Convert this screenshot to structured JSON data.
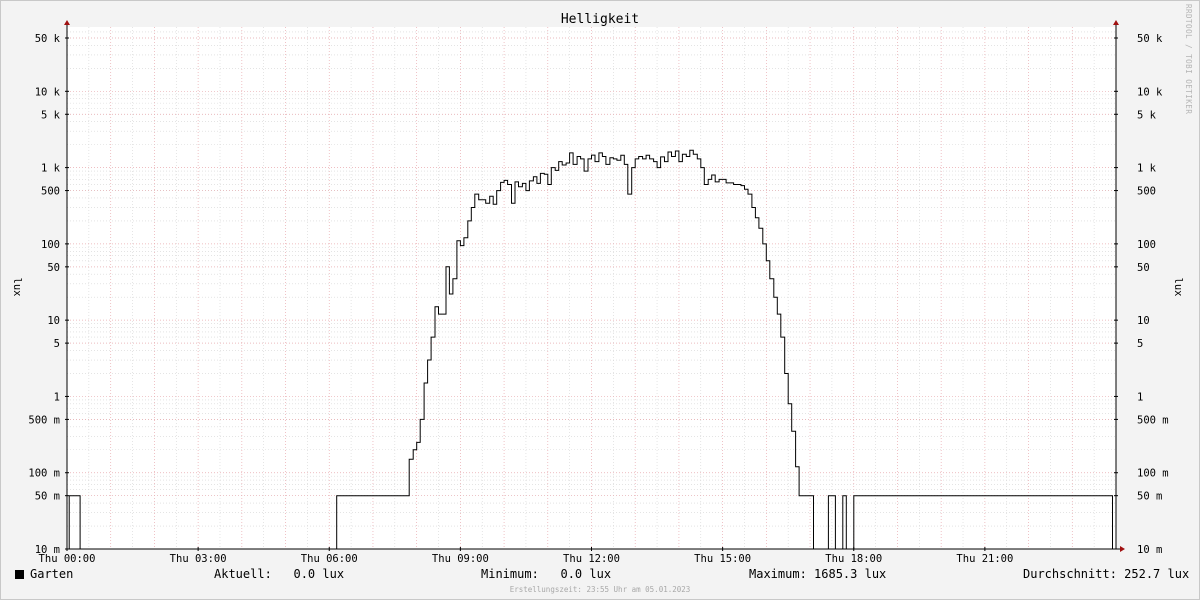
{
  "chart_data": {
    "type": "line",
    "title": "Helligkeit",
    "ylabel": "lux",
    "ylabel_right": "lux",
    "y_scale": "log",
    "ylim": [
      0.01,
      60000
    ],
    "y_ticks": [
      {
        "value": 0.01,
        "label": "10 m"
      },
      {
        "value": 0.05,
        "label": "50 m"
      },
      {
        "value": 0.1,
        "label": "100 m"
      },
      {
        "value": 0.5,
        "label": "500 m"
      },
      {
        "value": 1,
        "label": "1"
      },
      {
        "value": 5,
        "label": "5"
      },
      {
        "value": 10,
        "label": "10"
      },
      {
        "value": 50,
        "label": "50"
      },
      {
        "value": 100,
        "label": "100"
      },
      {
        "value": 500,
        "label": "500"
      },
      {
        "value": 1000,
        "label": "1 k"
      },
      {
        "value": 5000,
        "label": "5 k"
      },
      {
        "value": 10000,
        "label": "10 k"
      },
      {
        "value": 50000,
        "label": "50 k"
      }
    ],
    "x_unit": "hour",
    "xlim": [
      0,
      24
    ],
    "x_ticks": [
      {
        "value": 0,
        "label": "Thu 00:00"
      },
      {
        "value": 3,
        "label": "Thu 03:00"
      },
      {
        "value": 6,
        "label": "Thu 06:00"
      },
      {
        "value": 9,
        "label": "Thu 09:00"
      },
      {
        "value": 12,
        "label": "Thu 12:00"
      },
      {
        "value": 15,
        "label": "Thu 15:00"
      },
      {
        "value": 18,
        "label": "Thu 18:00"
      },
      {
        "value": 21,
        "label": "Thu 21:00"
      }
    ],
    "grid": true,
    "series": [
      {
        "name": "Garten",
        "color": "#000000",
        "points": [
          [
            0.0,
            0.01
          ],
          [
            0.05,
            0.05
          ],
          [
            0.3,
            0.01
          ],
          [
            6.17,
            0.05
          ],
          [
            7.83,
            0.15
          ],
          [
            7.92,
            0.2
          ],
          [
            8.0,
            0.25
          ],
          [
            8.08,
            0.5
          ],
          [
            8.17,
            1.5
          ],
          [
            8.25,
            3
          ],
          [
            8.33,
            6
          ],
          [
            8.42,
            15
          ],
          [
            8.5,
            12
          ],
          [
            8.67,
            50
          ],
          [
            8.75,
            22
          ],
          [
            8.83,
            35
          ],
          [
            8.92,
            110
          ],
          [
            9.0,
            95
          ],
          [
            9.08,
            120
          ],
          [
            9.17,
            200
          ],
          [
            9.25,
            300
          ],
          [
            9.33,
            450
          ],
          [
            9.42,
            380
          ],
          [
            9.58,
            340
          ],
          [
            9.67,
            420
          ],
          [
            9.75,
            330
          ],
          [
            9.83,
            500
          ],
          [
            9.92,
            640
          ],
          [
            10.0,
            680
          ],
          [
            10.08,
            600
          ],
          [
            10.17,
            340
          ],
          [
            10.25,
            650
          ],
          [
            10.33,
            560
          ],
          [
            10.42,
            620
          ],
          [
            10.5,
            500
          ],
          [
            10.58,
            670
          ],
          [
            10.67,
            760
          ],
          [
            10.75,
            620
          ],
          [
            10.83,
            840
          ],
          [
            10.92,
            820
          ],
          [
            11.0,
            600
          ],
          [
            11.08,
            1000
          ],
          [
            11.17,
            920
          ],
          [
            11.25,
            1200
          ],
          [
            11.33,
            1080
          ],
          [
            11.42,
            1150
          ],
          [
            11.5,
            1560
          ],
          [
            11.58,
            1100
          ],
          [
            11.67,
            1400
          ],
          [
            11.75,
            1300
          ],
          [
            11.83,
            900
          ],
          [
            11.92,
            1300
          ],
          [
            12.0,
            1460
          ],
          [
            12.08,
            1200
          ],
          [
            12.17,
            1560
          ],
          [
            12.25,
            1400
          ],
          [
            12.33,
            1100
          ],
          [
            12.42,
            1350
          ],
          [
            12.5,
            1300
          ],
          [
            12.58,
            1250
          ],
          [
            12.67,
            1450
          ],
          [
            12.75,
            1100
          ],
          [
            12.83,
            450
          ],
          [
            12.92,
            1000
          ],
          [
            13.0,
            1300
          ],
          [
            13.08,
            1400
          ],
          [
            13.17,
            1300
          ],
          [
            13.25,
            1450
          ],
          [
            13.33,
            1300
          ],
          [
            13.42,
            1200
          ],
          [
            13.5,
            1000
          ],
          [
            13.58,
            1380
          ],
          [
            13.67,
            1200
          ],
          [
            13.75,
            1600
          ],
          [
            13.83,
            1400
          ],
          [
            13.92,
            1650
          ],
          [
            14.0,
            1200
          ],
          [
            14.08,
            1500
          ],
          [
            14.17,
            1400
          ],
          [
            14.25,
            1685
          ],
          [
            14.33,
            1500
          ],
          [
            14.42,
            1300
          ],
          [
            14.5,
            1000
          ],
          [
            14.58,
            600
          ],
          [
            14.67,
            700
          ],
          [
            14.75,
            800
          ],
          [
            14.83,
            650
          ],
          [
            14.92,
            700
          ],
          [
            15.08,
            630
          ],
          [
            15.25,
            600
          ],
          [
            15.42,
            580
          ],
          [
            15.5,
            520
          ],
          [
            15.58,
            450
          ],
          [
            15.67,
            300
          ],
          [
            15.75,
            220
          ],
          [
            15.83,
            160
          ],
          [
            15.92,
            100
          ],
          [
            16.0,
            60
          ],
          [
            16.08,
            35
          ],
          [
            16.17,
            20
          ],
          [
            16.25,
            12
          ],
          [
            16.33,
            6
          ],
          [
            16.42,
            2
          ],
          [
            16.5,
            0.8
          ],
          [
            16.58,
            0.35
          ],
          [
            16.67,
            0.12
          ],
          [
            16.75,
            0.05
          ],
          [
            17.08,
            0.01
          ],
          [
            17.42,
            0.05
          ],
          [
            17.58,
            0.01
          ],
          [
            17.75,
            0.05
          ],
          [
            17.83,
            0.01
          ],
          [
            18.0,
            0.05
          ],
          [
            23.92,
            0.01
          ]
        ]
      }
    ]
  },
  "legend": {
    "series_name": "Garten",
    "current_label": "Aktuell:",
    "current_value": "0.0 lux",
    "min_label": "Minimum:",
    "min_value": "0.0 lux",
    "max_label": "Maximum:",
    "max_value": "1685.3 lux",
    "avg_label": "Durchschnitt:",
    "avg_value": "252.7 lux"
  },
  "created_text": "Erstellungszeit: 23:55 Uhr am 05.01.2023",
  "watermark": "RRDTOOL / TOBI OETIKER"
}
